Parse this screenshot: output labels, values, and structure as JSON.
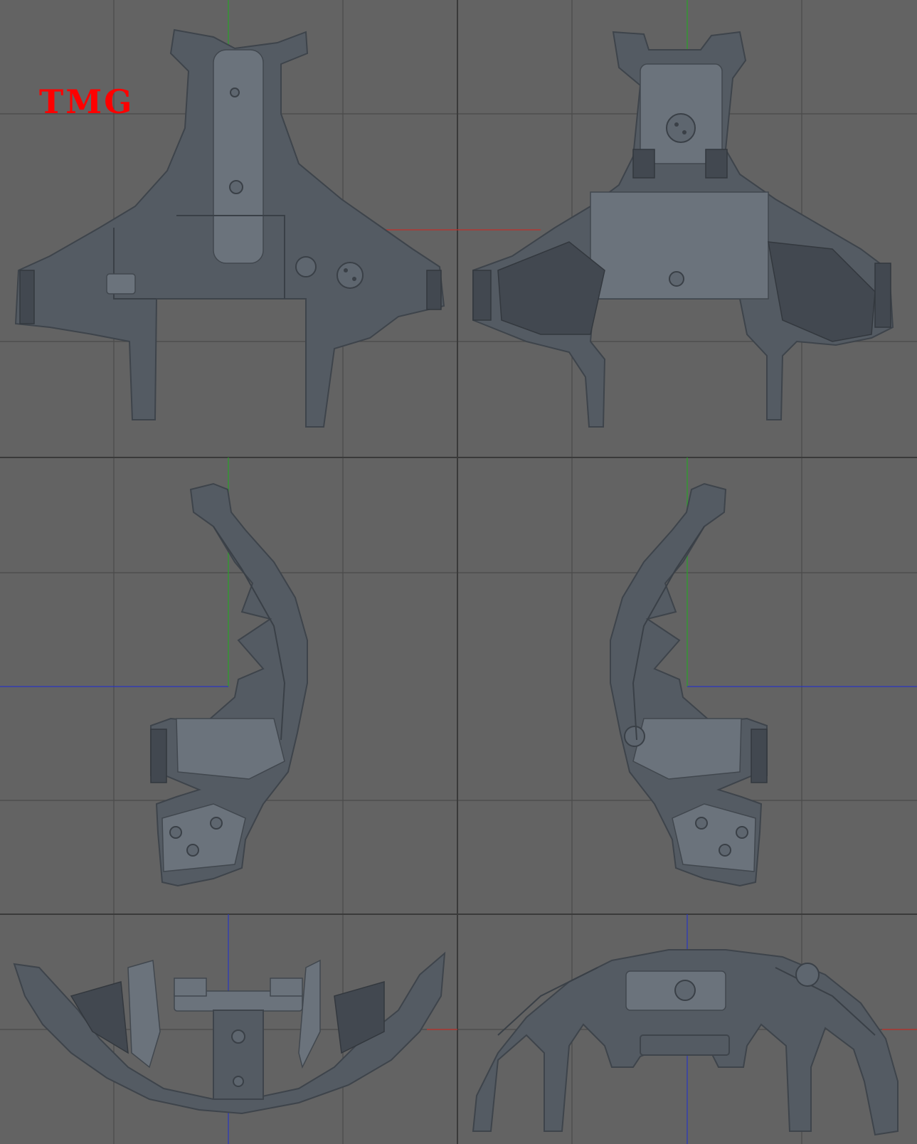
{
  "watermark": {
    "text": "TMG",
    "color": "#ff0000"
  },
  "viewport": {
    "background_color": "#636363",
    "grid_color": "#4a4a4a",
    "axis_colors": {
      "x": "#c0302a",
      "y": "#28a028",
      "z": "#2a36c0"
    },
    "model_color": "#545b63"
  },
  "views": [
    {
      "id": "top",
      "model": "helmet-shell"
    },
    {
      "id": "bottom",
      "model": "helmet-shell"
    },
    {
      "id": "left",
      "model": "helmet-shell"
    },
    {
      "id": "right",
      "model": "helmet-shell"
    },
    {
      "id": "front",
      "model": "helmet-shell"
    },
    {
      "id": "back",
      "model": "helmet-shell"
    }
  ]
}
